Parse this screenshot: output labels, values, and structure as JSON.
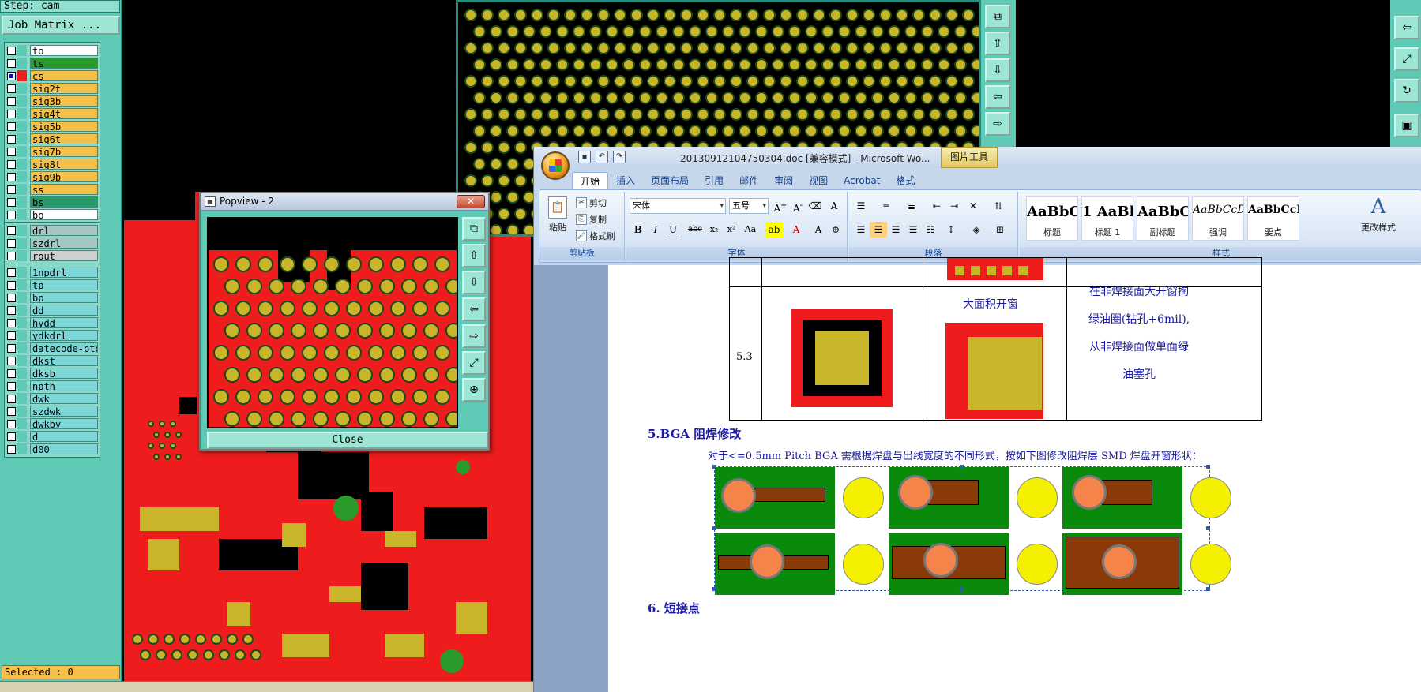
{
  "cam": {
    "step_label": "Step: cam",
    "job_matrix": "Job Matrix ...",
    "selected_status": "Selected : 0",
    "groups": [
      {
        "layers": [
          {
            "name": "to",
            "color": "#ffffff",
            "checked": false,
            "swatch": "#5ec9b4"
          },
          {
            "name": "ts",
            "color": "#2a9a2a",
            "checked": false,
            "swatch": "#5ec9b4"
          },
          {
            "name": "cs",
            "color": "#f5c04a",
            "checked": true,
            "swatch": "#ee1c1c"
          },
          {
            "name": "sig2t",
            "color": "#f5c04a",
            "checked": false,
            "swatch": "#5ec9b4"
          },
          {
            "name": "sig3b",
            "color": "#f5c04a",
            "checked": false,
            "swatch": "#5ec9b4"
          },
          {
            "name": "sig4t",
            "color": "#f5c04a",
            "checked": false,
            "swatch": "#5ec9b4"
          },
          {
            "name": "sig5b",
            "color": "#f5c04a",
            "checked": false,
            "swatch": "#5ec9b4"
          },
          {
            "name": "sig6t",
            "color": "#f5c04a",
            "checked": false,
            "swatch": "#5ec9b4"
          },
          {
            "name": "sig7b",
            "color": "#f5c04a",
            "checked": false,
            "swatch": "#5ec9b4"
          },
          {
            "name": "sig8t",
            "color": "#f5c04a",
            "checked": false,
            "swatch": "#5ec9b4"
          },
          {
            "name": "sig9b",
            "color": "#f5c04a",
            "checked": false,
            "swatch": "#5ec9b4"
          },
          {
            "name": "ss",
            "color": "#f5c04a",
            "checked": false,
            "swatch": "#5ec9b4"
          },
          {
            "name": "bs",
            "color": "#2a9a6a",
            "checked": false,
            "swatch": "#5ec9b4"
          },
          {
            "name": "bo",
            "color": "#ffffff",
            "checked": false,
            "swatch": "#5ec9b4"
          }
        ]
      },
      {
        "layers": [
          {
            "name": "drl",
            "color": "#a6c6c6",
            "checked": false,
            "swatch": "#5ec9b4"
          },
          {
            "name": "szdrl",
            "color": "#a6c6c6",
            "checked": false,
            "swatch": "#5ec9b4"
          },
          {
            "name": "rout",
            "color": "#cfcfcf",
            "checked": false,
            "swatch": "#5ec9b4"
          }
        ]
      },
      {
        "layers": [
          {
            "name": "1npdrl",
            "color": "#7fd6d6",
            "checked": false,
            "swatch": "#5ec9b4"
          },
          {
            "name": "tp",
            "color": "#7fd6d6",
            "checked": false,
            "swatch": "#5ec9b4"
          },
          {
            "name": "bp",
            "color": "#7fd6d6",
            "checked": false,
            "swatch": "#5ec9b4"
          },
          {
            "name": "dd",
            "color": "#7fd6d6",
            "checked": false,
            "swatch": "#5ec9b4"
          },
          {
            "name": "hydd",
            "color": "#7fd6d6",
            "checked": false,
            "swatch": "#5ec9b4"
          },
          {
            "name": "ydkdrl",
            "color": "#7fd6d6",
            "checked": false,
            "swatch": "#5ec9b4"
          },
          {
            "name": "datecode-pto",
            "color": "#7fd6d6",
            "checked": false,
            "swatch": "#5ec9b4"
          },
          {
            "name": "dkst",
            "color": "#7fd6d6",
            "checked": false,
            "swatch": "#5ec9b4"
          },
          {
            "name": "dksb",
            "color": "#7fd6d6",
            "checked": false,
            "swatch": "#5ec9b4"
          },
          {
            "name": "npth",
            "color": "#7fd6d6",
            "checked": false,
            "swatch": "#5ec9b4"
          },
          {
            "name": "dwk",
            "color": "#7fd6d6",
            "checked": false,
            "swatch": "#5ec9b4"
          },
          {
            "name": "szdwk",
            "color": "#7fd6d6",
            "checked": false,
            "swatch": "#5ec9b4"
          },
          {
            "name": "dwkby",
            "color": "#7fd6d6",
            "checked": false,
            "swatch": "#5ec9b4"
          },
          {
            "name": "d",
            "color": "#7fd6d6",
            "checked": false,
            "swatch": "#5ec9b4"
          },
          {
            "name": "d00",
            "color": "#7fd6d6",
            "checked": false,
            "swatch": "#5ec9b4"
          }
        ]
      }
    ]
  },
  "popview": {
    "title": "Popview - 2",
    "close_label": "Close",
    "close_x": "✕"
  },
  "word": {
    "doc_title": "20130912104750304.doc [兼容模式] - Microsoft Wo...",
    "picture_tools": "图片工具",
    "tabs": [
      "开始",
      "插入",
      "页面布局",
      "引用",
      "邮件",
      "审阅",
      "视图",
      "Acrobat",
      "格式"
    ],
    "clipboard": {
      "paste": "粘贴",
      "cut": "剪切",
      "copy": "复制",
      "format_painter": "格式刷",
      "group": "剪贴板"
    },
    "font": {
      "name": "宋体",
      "size": "五号",
      "group": "字体"
    },
    "paragraph": {
      "group": "段落"
    },
    "styles": {
      "group": "样式",
      "change_styles": "更改样式",
      "tiles": [
        {
          "sample": "AaBbC",
          "name": "标题"
        },
        {
          "sample": "1 AaBl",
          "name": "标题 1"
        },
        {
          "sample": "AaBbC",
          "name": "副标题"
        },
        {
          "sample": "AaBbCcDd",
          "name": "强调"
        },
        {
          "sample": "AaBbCcD",
          "name": "要点"
        }
      ]
    },
    "doc": {
      "row_number": "5.3",
      "cell_title": "大面积开窗",
      "cell_desc_lines": [
        "在非焊接面大开窗掏",
        "绿油圈(钻孔+6mil),",
        "从非焊接面做单面绿",
        "油塞孔"
      ],
      "heading_5": "5.BGA 阻焊修改",
      "paragraph_5": "对于<=0.5mm Pitch BGA 需根据焊盘与出线宽度的不同形式，按如下图修改阻焊层 SMD 焊盘开窗形状：",
      "heading_6": "6.  短接点"
    }
  }
}
